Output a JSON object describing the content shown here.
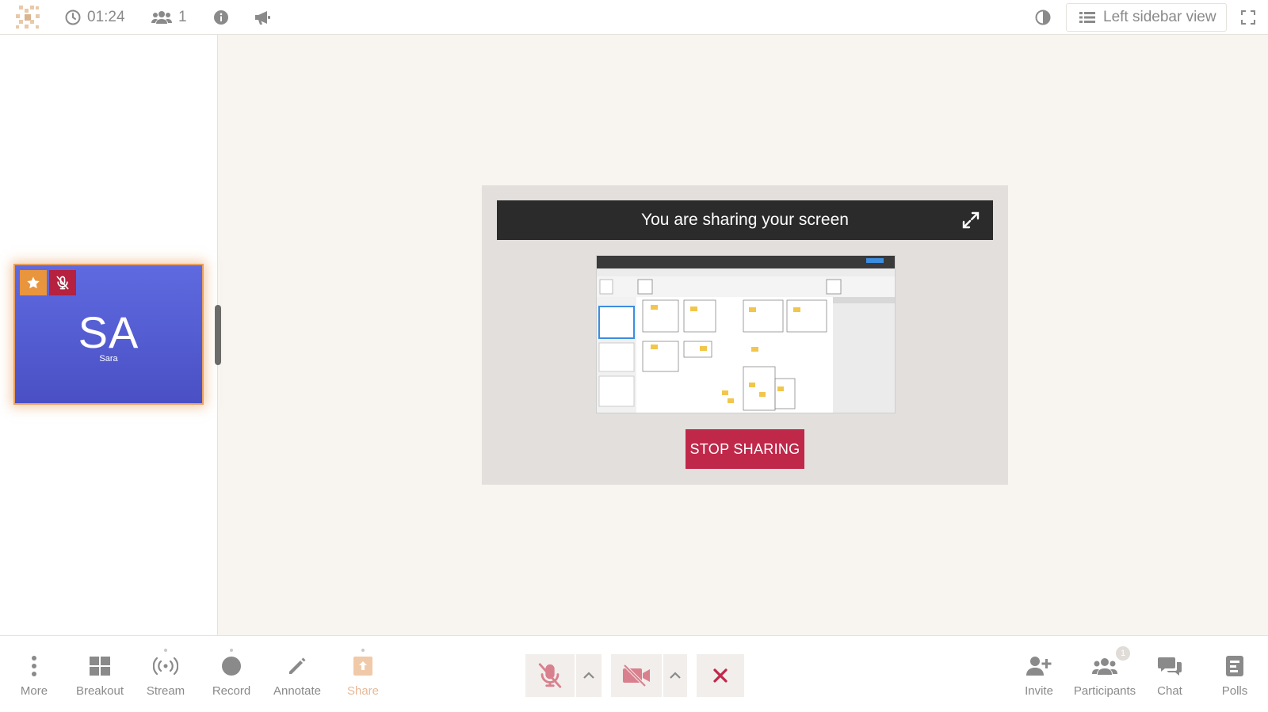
{
  "topbar": {
    "timer": "01:24",
    "participant_count": "1",
    "layout_button_label": "Left sidebar view"
  },
  "participant_tile": {
    "initials": "SA",
    "name": "Sara",
    "avatar_color": "#5560d6",
    "highlight_color": "#e8a062"
  },
  "share": {
    "header": "You are sharing your screen",
    "stop_label": "STOP SHARING",
    "stop_color": "#c0284a"
  },
  "toolbar_left": [
    {
      "label": "More",
      "icon": "more-vertical-icon"
    },
    {
      "label": "Breakout",
      "icon": "grid-icon"
    },
    {
      "label": "Stream",
      "icon": "broadcast-icon"
    },
    {
      "label": "Record",
      "icon": "record-icon"
    },
    {
      "label": "Annotate",
      "icon": "pencil-icon"
    },
    {
      "label": "Share",
      "icon": "share-screen-icon"
    }
  ],
  "toolbar_right": [
    {
      "label": "Invite",
      "icon": "add-user-icon"
    },
    {
      "label": "Participants",
      "icon": "participants-icon",
      "badge": "1"
    },
    {
      "label": "Chat",
      "icon": "chat-icon"
    },
    {
      "label": "Polls",
      "icon": "polls-icon"
    }
  ],
  "colors": {
    "accent_red": "#c0284a",
    "muted_red": "#d9808e",
    "background": "#f8f5f1"
  }
}
